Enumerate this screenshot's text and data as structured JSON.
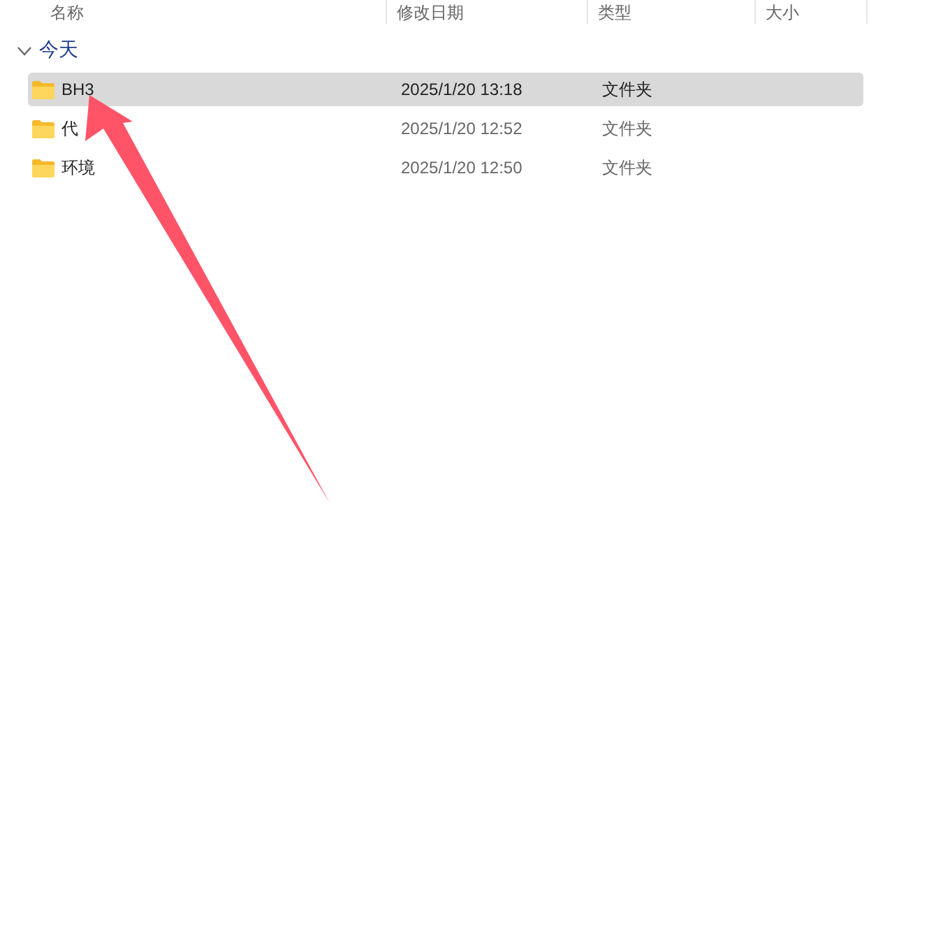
{
  "columns": [
    {
      "label": "名称"
    },
    {
      "label": "修改日期"
    },
    {
      "label": "类型"
    },
    {
      "label": "大小"
    }
  ],
  "group": {
    "label": "今天",
    "expanded": true
  },
  "rows": [
    {
      "name": "BH3",
      "modified": "2025/1/20 13:18",
      "type": "文件夹",
      "selected": true
    },
    {
      "name": "代",
      "modified": "2025/1/20 12:52",
      "type": "文件夹",
      "selected": false
    },
    {
      "name": "环境",
      "modified": "2025/1/20 12:50",
      "type": "文件夹",
      "selected": false
    }
  ]
}
